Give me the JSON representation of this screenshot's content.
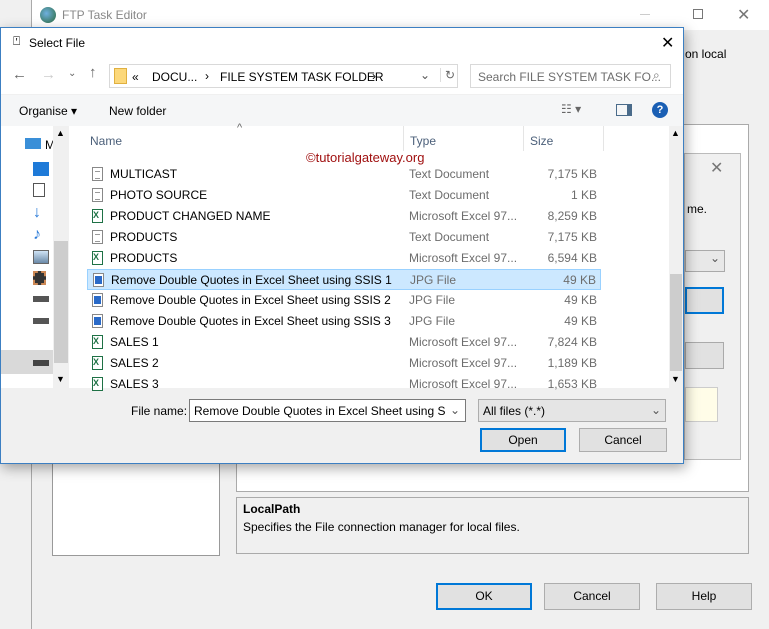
{
  "ftp_editor": {
    "title": "FTP Task Editor",
    "partial_text": "on local",
    "partial_text2": "me.",
    "description_title": "LocalPath",
    "description_text": "Specifies the File connection manager for local files.",
    "ok": "OK",
    "cancel": "Cancel",
    "help": "Help"
  },
  "select_file": {
    "title": "Select File",
    "breadcrumb": [
      "«",
      "DOCU...",
      "FILE SYSTEM TASK FOLDER"
    ],
    "search_placeholder": "Search FILE SYSTEM TASK FO...",
    "organise": "Organise ▾",
    "new_folder": "New folder",
    "columns": {
      "name": "Name",
      "type": "Type",
      "size": "Size"
    },
    "watermark": "©tutorialgateway.org",
    "nav_partial": "M",
    "files": [
      {
        "name": "MULTICAST",
        "type": "Text Document",
        "size": "7,175 KB",
        "icon": "text"
      },
      {
        "name": "PHOTO SOURCE",
        "type": "Text Document",
        "size": "1 KB",
        "icon": "text"
      },
      {
        "name": "PRODUCT CHANGED NAME",
        "type": "Microsoft Excel 97...",
        "size": "8,259 KB",
        "icon": "excel"
      },
      {
        "name": "PRODUCTS",
        "type": "Text Document",
        "size": "7,175 KB",
        "icon": "text"
      },
      {
        "name": "PRODUCTS",
        "type": "Microsoft Excel 97...",
        "size": "6,594 KB",
        "icon": "excel"
      },
      {
        "name": "Remove Double Quotes in Excel Sheet using SSIS 1",
        "type": "JPG File",
        "size": "49 KB",
        "icon": "jpg",
        "selected": true
      },
      {
        "name": "Remove Double Quotes in Excel Sheet using SSIS 2",
        "type": "JPG File",
        "size": "49 KB",
        "icon": "jpg"
      },
      {
        "name": "Remove Double Quotes in Excel Sheet using SSIS 3",
        "type": "JPG File",
        "size": "49 KB",
        "icon": "jpg"
      },
      {
        "name": "SALES 1",
        "type": "Microsoft Excel 97...",
        "size": "7,824 KB",
        "icon": "excel"
      },
      {
        "name": "SALES 2",
        "type": "Microsoft Excel 97...",
        "size": "1,189 KB",
        "icon": "excel"
      },
      {
        "name": "SALES 3",
        "type": "Microsoft Excel 97...",
        "size": "1,653 KB",
        "icon": "excel"
      }
    ],
    "file_name_label": "File name:",
    "file_name_value": "Remove Double Quotes in Excel Sheet using SSIS",
    "filter": "All files (*.*)",
    "open": "Open",
    "cancel": "Cancel"
  }
}
